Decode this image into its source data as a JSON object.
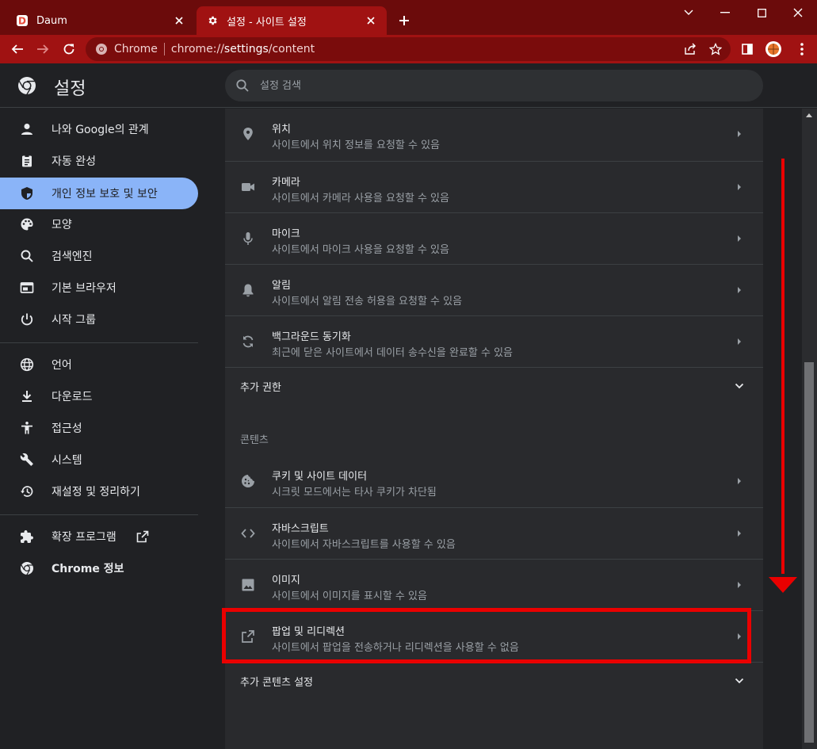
{
  "browser": {
    "tabs": [
      {
        "title": "Daum",
        "active": false
      },
      {
        "title": "설정 - 사이트 설정",
        "active": true
      }
    ],
    "omnibox": {
      "chip": "Chrome",
      "url_prefix": "chrome://",
      "url_main": "settings",
      "url_suffix": "/content"
    }
  },
  "header": {
    "title": "설정",
    "search_placeholder": "설정 검색"
  },
  "sidebar": {
    "items": [
      {
        "label": "나와 Google의 관계",
        "icon": "person-icon"
      },
      {
        "label": "자동 완성",
        "icon": "clipboard-icon"
      },
      {
        "label": "개인 정보 보호 및 보안",
        "icon": "shield-icon",
        "selected": true
      },
      {
        "label": "모양",
        "icon": "palette-icon"
      },
      {
        "label": "검색엔진",
        "icon": "search-icon"
      },
      {
        "label": "기본 브라우저",
        "icon": "browser-icon"
      },
      {
        "label": "시작 그룹",
        "icon": "power-icon"
      },
      {
        "label": "언어",
        "icon": "globe-icon"
      },
      {
        "label": "다운로드",
        "icon": "download-icon"
      },
      {
        "label": "접근성",
        "icon": "accessibility-icon"
      },
      {
        "label": "시스템",
        "icon": "wrench-icon"
      },
      {
        "label": "재설정 및 정리하기",
        "icon": "history-icon"
      },
      {
        "label": "확장 프로그램",
        "icon": "puzzle-icon"
      },
      {
        "label": "Chrome 정보",
        "icon": "chrome-icon"
      }
    ]
  },
  "permissions": [
    {
      "title": "위치",
      "subtitle": "사이트에서 위치 정보를 요청할 수 있음",
      "icon": "location-icon"
    },
    {
      "title": "카메라",
      "subtitle": "사이트에서 카메라 사용을 요청할 수 있음",
      "icon": "camera-icon"
    },
    {
      "title": "마이크",
      "subtitle": "사이트에서 마이크 사용을 요청할 수 있음",
      "icon": "mic-icon"
    },
    {
      "title": "알림",
      "subtitle": "사이트에서 알림 전송 허용을 요청할 수 있음",
      "icon": "bell-icon"
    },
    {
      "title": "백그라운드 동기화",
      "subtitle": "최근에 닫은 사이트에서 데이터 송수신을 완료할 수 있음",
      "icon": "sync-icon"
    }
  ],
  "additional_permissions": "추가 권한",
  "content_section_label": "콘텐츠",
  "content": [
    {
      "title": "쿠키 및 사이트 데이터",
      "subtitle": "시크릿 모드에서는 타사 쿠키가 차단됨",
      "icon": "cookie-icon"
    },
    {
      "title": "자바스크립트",
      "subtitle": "사이트에서 자바스크립트를 사용할 수 있음",
      "icon": "code-icon"
    },
    {
      "title": "이미지",
      "subtitle": "사이트에서 이미지를 표시할 수 있음",
      "icon": "image-icon"
    },
    {
      "title": "팝업 및 리디렉션",
      "subtitle": "사이트에서 팝업을 전송하거나 리디렉션을 사용할 수 없음",
      "icon": "open-in-new-icon"
    }
  ],
  "additional_content": "추가 콘텐츠 설정",
  "colors": {
    "accent": "#8ab4f8",
    "annotation": "#ea0000",
    "frame": "#a01212"
  }
}
